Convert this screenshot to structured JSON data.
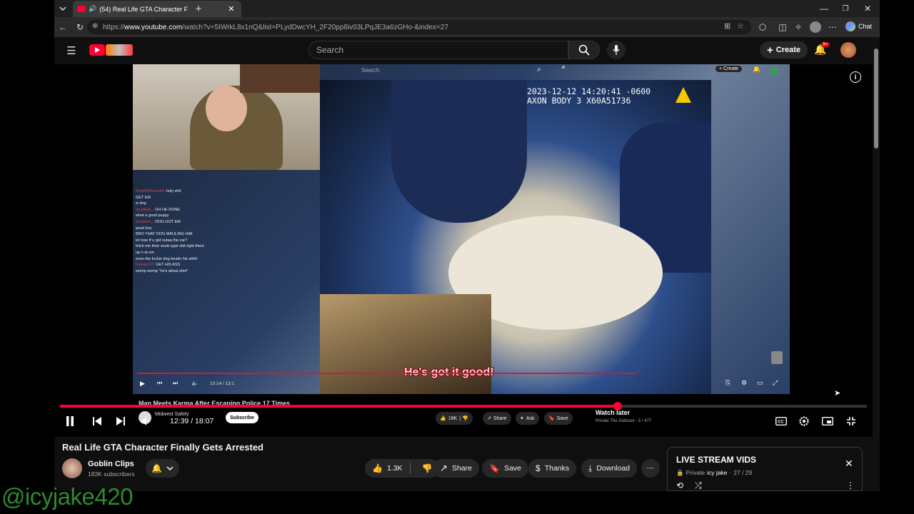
{
  "browser": {
    "tab_title": "(54) Real Life GTA Character F",
    "url_prefix": "https://",
    "url_host": "www.youtube.com",
    "url_rest": "/watch?v=5IWrkL8x1nQ&list=PLydDwcYH_2F20pp8iv03LPqJE3a6zGHo-&index=27",
    "chat_label": "Chat"
  },
  "youtube": {
    "search_placeholder": "Search",
    "create_label": "Create",
    "notif_badge": "9+"
  },
  "video": {
    "timestamp_line1": "2023-12-12 14:20:41 -0600",
    "timestamp_line2": "AXON BODY 3 X60A51736",
    "subtitle": "He's got it good!",
    "inner_search": "Search",
    "inner_create": "Create",
    "inner_time": "10:14 / 13:1",
    "inner_title": "Man Meets Karma After Escaping Police 17 Times",
    "inner_channel": "Midwest Safety",
    "inner_subscribe": "Subscribe",
    "inner_like": "18K",
    "inner_share": "Share",
    "inner_ask": "Ask",
    "inner_save": "Save",
    "inner_watch_later": "Watch later",
    "inner_playlist_meta": "Private The Gobcast - 5 / 477",
    "chat": [
      {
        "name": "RealMKBakedAl",
        "msg": "holy shit"
      },
      {
        "name": "",
        "msg": "GET EM"
      },
      {
        "name": "",
        "msg": "w dog"
      },
      {
        "name": "deadleet_",
        "msg": "OH HE DONE"
      },
      {
        "name": "",
        "msg": "what a good puppy"
      },
      {
        "name": "deadleet_",
        "msg": "DOG GOT EM"
      },
      {
        "name": "",
        "msg": "good boy"
      },
      {
        "name": "",
        "msg": "BRO THAT DOG MAULING HIM"
      },
      {
        "name": "",
        "msg": "lol how tf u get outaa the car?"
      },
      {
        "name": "",
        "msg": "fetch me their souls type shit right there"
      },
      {
        "name": "",
        "msg": "up n at em"
      },
      {
        "name": "",
        "msg": "even the fuckin dog beatin his ahhh"
      },
      {
        "name": "rhisklen23",
        "msg": "GET HIS ASS"
      },
      {
        "name": "",
        "msg": "womp womp \"he's about shot\""
      }
    ]
  },
  "player": {
    "progress_fraction": 0.691,
    "current_time": "12:39",
    "total_time": "18:07",
    "time_label": "12:39 / 18:07"
  },
  "page": {
    "title": "Real Life GTA Character Finally Gets Arrested",
    "channel": "Goblin Clips",
    "subscribers": "183K subscribers",
    "like_count": "1.3K",
    "share_label": "Share",
    "save_label": "Save",
    "thanks_label": "Thanks",
    "download_label": "Download"
  },
  "playlist": {
    "title": "LIVE STREAM VIDS",
    "meta_private": "Private",
    "meta_owner": "icy jake",
    "meta_position": "27 / 29"
  },
  "overlay": {
    "watermark": "@icyjake420"
  },
  "colors": {
    "accent": "#ff0033",
    "watermark": "#2e8b2e",
    "background": "#0f0f0f"
  }
}
